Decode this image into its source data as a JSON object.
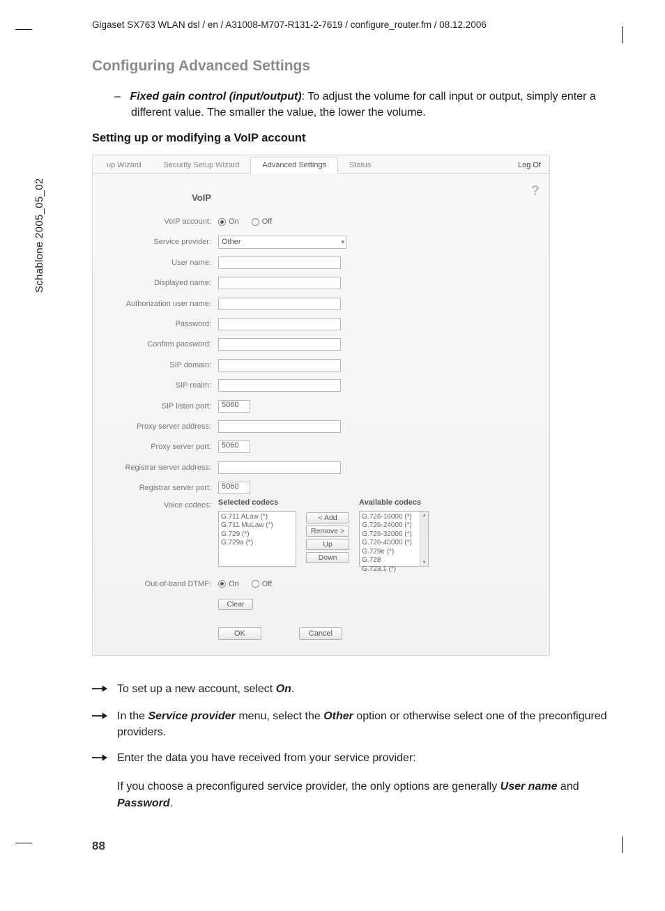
{
  "meta_header": "Gigaset SX763 WLAN dsl / en / A31008-M707-R131-2-7619 / configure_router.fm / 08.12.2006",
  "side_text": "Schablone 2005_05_02",
  "title": "Configuring Advanced Settings",
  "para_gain": {
    "lead_bold": "Fixed gain control (input/output)",
    "rest": ": To adjust the volume for call input or output, simply enter a different value. The smaller the value, the lower the volume."
  },
  "subheading": "Setting up or modifying a VoIP account",
  "shot": {
    "tabs": {
      "wizard": "up Wizard",
      "security": "Security Setup Wizard",
      "advanced": "Advanced Settings",
      "status": "Status",
      "logoff": "Log Of"
    },
    "section_title": "VoIP",
    "labels": {
      "voip_account": "VoIP account:",
      "service_provider": "Service provider:",
      "user_name": "User name:",
      "displayed_name": "Displayed name:",
      "auth_user": "Authorization user name:",
      "password": "Password:",
      "confirm_password": "Confirm password:",
      "sip_domain": "SIP domain:",
      "sip_realm": "SIP realm:",
      "sip_listen_port": "SIP listen port:",
      "proxy_addr": "Proxy server address:",
      "proxy_port": "Proxy server port:",
      "reg_addr": "Registrar server address:",
      "reg_port": "Registrar server port:",
      "voice_codecs": "Voice codecs:",
      "oob_dtmf": "Out-of-band DTMF:"
    },
    "radios": {
      "on": "On",
      "off": "Off"
    },
    "provider_value": "Other",
    "port_5060": "5060",
    "codec_headers": {
      "selected": "Selected codecs",
      "available": "Available codecs"
    },
    "codecs_selected": [
      "G.711 ALaw (*)",
      "G.711 MuLaw (*)",
      "G.729 (*)",
      "G.729a (*)"
    ],
    "codecs_available": [
      "G.726-16000 (*)",
      "G.726-24000 (*)",
      "G.726-32000 (*)",
      "G.726-40000 (*)",
      "G.729e (*)",
      "G.728",
      "G.723.1 (*)"
    ],
    "codec_btns": {
      "add": "< Add",
      "remove": "Remove >",
      "up": "Up",
      "down": "Down"
    },
    "buttons": {
      "clear": "Clear",
      "ok": "OK",
      "cancel": "Cancel"
    }
  },
  "instr": {
    "i1_a": "To set up a new account, select ",
    "i1_b": "On",
    "i1_c": ".",
    "i2_a": "In the ",
    "i2_b": "Service provider",
    "i2_c": " menu, select the ",
    "i2_d": "Other",
    "i2_e": " option or otherwise select one of the preconfigured providers.",
    "i3": "Enter the data you have received from your service provider:",
    "i3_sub_a": "If you choose a preconfigured service provider, the only options are generally ",
    "i3_sub_b": "User name",
    "i3_sub_c": " and ",
    "i3_sub_d": "Password",
    "i3_sub_e": "."
  },
  "page_number": "88"
}
